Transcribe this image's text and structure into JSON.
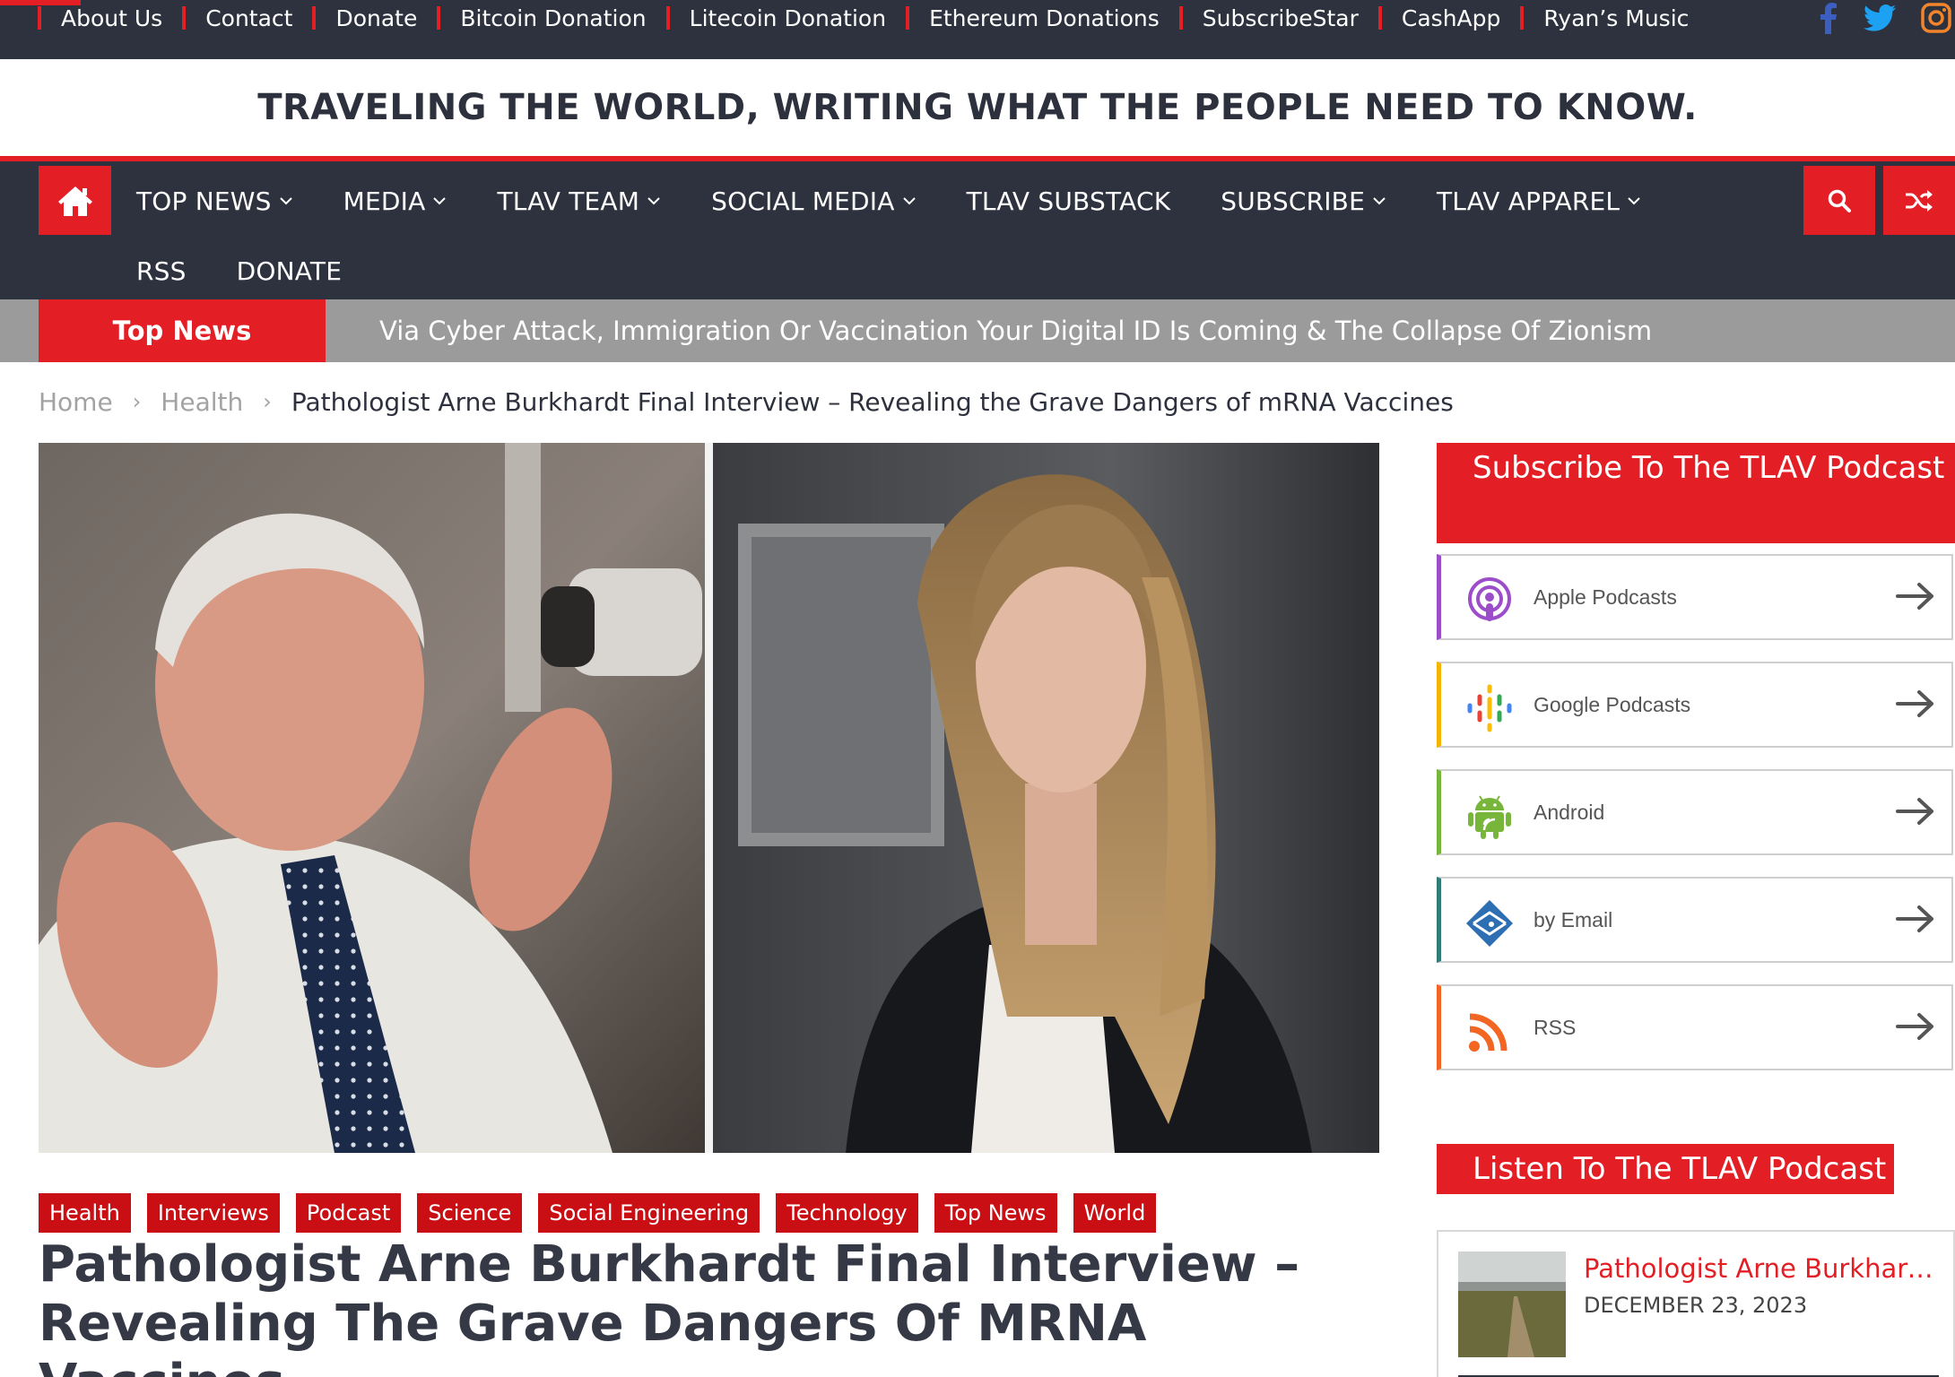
{
  "topbar": {
    "links": [
      "About Us",
      "Contact",
      "Donate",
      "Bitcoin Donation",
      "Litecoin Donation",
      "Ethereum Donations",
      "SubscribeStar",
      "CashApp",
      "Ryan’s Music"
    ],
    "social_icons": [
      "facebook-icon",
      "twitter-icon",
      "instagram-icon"
    ]
  },
  "tagline": "TRAVELING THE WORLD, WRITING WHAT THE PEOPLE NEED TO KNOW.",
  "nav": {
    "home_icon": "home-icon",
    "items": [
      {
        "label": "TOP NEWS",
        "has_dropdown": true
      },
      {
        "label": "MEDIA",
        "has_dropdown": true
      },
      {
        "label": "TLAV TEAM",
        "has_dropdown": true
      },
      {
        "label": "SOCIAL MEDIA",
        "has_dropdown": true
      },
      {
        "label": "TLAV SUBSTACK",
        "has_dropdown": false
      },
      {
        "label": "SUBSCRIBE",
        "has_dropdown": true
      },
      {
        "label": "TLAV APPAREL",
        "has_dropdown": true
      },
      {
        "label": "RSS",
        "has_dropdown": false
      },
      {
        "label": "DONATE",
        "has_dropdown": false
      }
    ],
    "right_icons": [
      "search-icon",
      "shuffle-icon"
    ]
  },
  "ticker": {
    "label": "Top News",
    "headline": "Via Cyber Attack, Immigration Or Vaccination Your Digital ID Is Coming & The Collapse Of Zionism"
  },
  "breadcrumb": {
    "items": [
      "Home",
      "Health"
    ],
    "current": "Pathologist Arne Burkhardt Final Interview – Revealing the Grave Dangers of mRNA Vaccines"
  },
  "post": {
    "categories": [
      "Health",
      "Interviews",
      "Podcast",
      "Science",
      "Social Engineering",
      "Technology",
      "Top News",
      "World"
    ],
    "title": "Pathologist Arne Burkhardt Final Interview – Revealing The Grave Dangers Of MRNA Vaccines"
  },
  "sidebar": {
    "subscribe_heading": "Subscribe To The TLAV Podcast",
    "podcast_links": [
      {
        "label": "Apple Podcasts",
        "icon": "apple-podcasts-icon",
        "color": "#9b4dca"
      },
      {
        "label": "Google Podcasts",
        "icon": "google-podcasts-icon",
        "color": "#f4b400"
      },
      {
        "label": "Android",
        "icon": "android-icon",
        "color": "#78b63b"
      },
      {
        "label": "by Email",
        "icon": "email-icon",
        "color": "#2f7c7a"
      },
      {
        "label": "RSS",
        "icon": "rss-icon",
        "color": "#f26522"
      }
    ],
    "listen_heading": "Listen To The TLAV Podcast",
    "recent_post": {
      "title": "Pathologist Arne Burkhardt Final Interview – Revealing the Grave Dangers of mRNA Vaccines",
      "date": "DECEMBER 23, 2023"
    }
  },
  "colors": {
    "accent": "#e31e24",
    "dark": "#2e323e",
    "ticker_bg": "#9b9b9b"
  }
}
